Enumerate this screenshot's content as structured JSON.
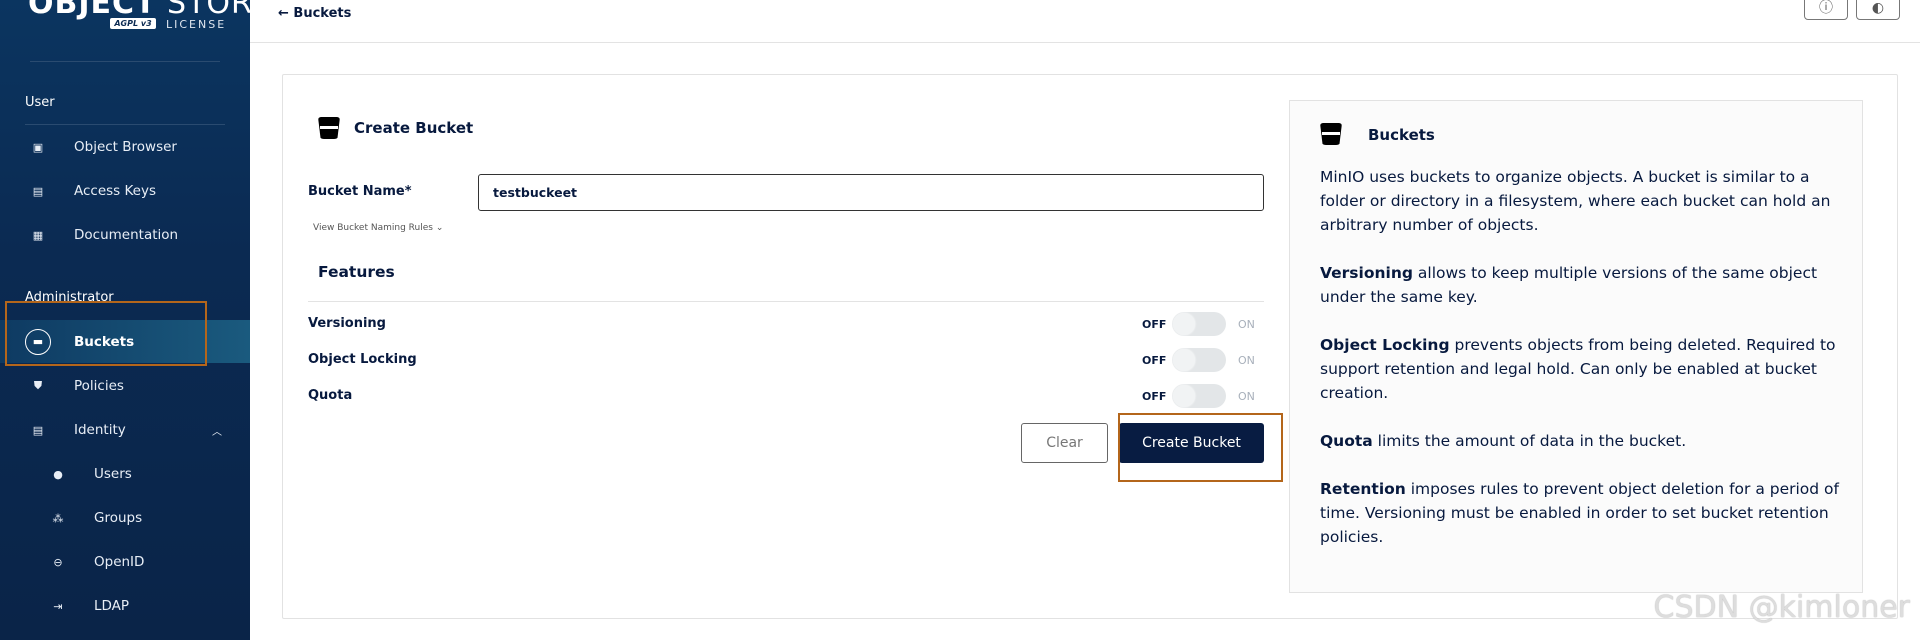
{
  "sidebar": {
    "logo": {
      "title_bold": "OBJECT",
      "title_light": " STORE",
      "badge": "AGPL v3",
      "license": "LICENSE"
    },
    "sections": [
      {
        "label": "User"
      },
      {
        "label": "Administrator"
      }
    ],
    "user_items": [
      {
        "label": "Object Browser",
        "icon": "object-browser-icon"
      },
      {
        "label": "Access Keys",
        "icon": "access-keys-icon"
      },
      {
        "label": "Documentation",
        "icon": "documentation-icon"
      }
    ],
    "admin_items": [
      {
        "label": "Buckets",
        "icon": "bucket-icon",
        "active": true
      },
      {
        "label": "Policies",
        "icon": "shield-icon"
      },
      {
        "label": "Identity",
        "icon": "identity-icon",
        "expanded": true
      }
    ],
    "identity_items": [
      {
        "label": "Users",
        "icon": "user-icon"
      },
      {
        "label": "Groups",
        "icon": "groups-icon"
      },
      {
        "label": "OpenID",
        "icon": "openid-icon"
      },
      {
        "label": "LDAP",
        "icon": "ldap-icon"
      }
    ]
  },
  "header": {
    "back_label": "Buckets",
    "buttons": [
      {
        "icon": "info-icon"
      },
      {
        "icon": "theme-toggle-icon"
      }
    ]
  },
  "form": {
    "title": "Create Bucket",
    "bucket_name_label": "Bucket Name*",
    "bucket_name_value": "testbuckeet",
    "naming_rules_link": "View Bucket Naming Rules",
    "features_title": "Features",
    "features": [
      {
        "label": "Versioning",
        "state": "OFF"
      },
      {
        "label": "Object Locking",
        "state": "OFF"
      },
      {
        "label": "Quota",
        "state": "OFF"
      }
    ],
    "off_label": "OFF",
    "on_label": "ON",
    "clear_label": "Clear",
    "create_label": "Create Bucket"
  },
  "info": {
    "title": "Buckets",
    "intro": "MinIO uses buckets to organize objects. A bucket is similar to a folder or directory in a filesystem, where each bucket can hold an arbitrary number of objects.",
    "items": [
      {
        "term": "Versioning",
        "text": " allows to keep multiple versions of the same object under the same key."
      },
      {
        "term": "Object Locking",
        "text": " prevents objects from being deleted. Required to support retention and legal hold. Can only be enabled at bucket creation."
      },
      {
        "term": "Quota",
        "text": " limits the amount of data in the bucket."
      },
      {
        "term": "Retention",
        "text": " imposes rules to prevent object deletion for a period of time. Versioning must be enabled in order to set bucket retention policies."
      }
    ]
  },
  "watermark": "CSDN @kimloner",
  "colors": {
    "sidebar": "#0b2a52",
    "primary_button": "#081c42",
    "highlight": "#b4661b"
  }
}
